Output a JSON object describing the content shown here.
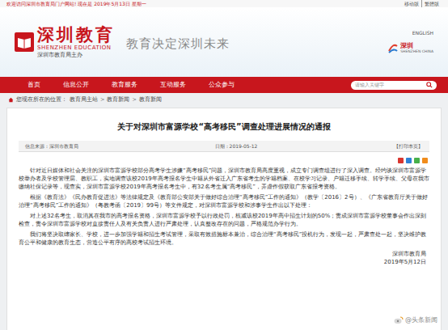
{
  "topbar": {
    "welcome": "欢迎访问深圳市教育局门户网站! 现在是 2019年5月13日 星期一",
    "links": [
      "移动版",
      "繁體版"
    ]
  },
  "header": {
    "brand": "深圳教育",
    "brand_en": "SHENZHEN EDUCATION",
    "sponsor": "深圳市教育局主办",
    "slogan": "教育决定深圳未来",
    "english": "ENGLISH",
    "city_logo": "深圳",
    "city_logo_en": "SHENZHEN CHINA"
  },
  "nav": {
    "items": [
      {
        "label": "首页",
        "selected": false
      },
      {
        "label": "信息公开",
        "selected": false
      },
      {
        "label": "教育服务",
        "selected": false
      },
      {
        "label": "互动服务",
        "selected": false
      },
      {
        "label": "公众参与",
        "selected": false
      }
    ],
    "search_placeholder": "请输入关键字"
  },
  "breadcrumb": {
    "prefix": "您现在所在的位置：",
    "items": [
      "教育局主站",
      "教育新闻",
      "教育新闻"
    ],
    "separator": ">"
  },
  "article": {
    "title": "关于对深圳市富源学校“高考移民”调查处理进展情况的通报",
    "source": "信息来源：深圳市教育局",
    "date": "日期：2019-05-12",
    "print": "【打印本页】",
    "paragraphs": [
      "针对近日媒体和社会关注的深圳市富源学校部分高考学生涉嫌“高考移民”问题，深圳市教育局高度重视，成立专门调查组进行了深入调查。经约谈深圳市富源学校举办者及学校管理层、教职工，实地调查该校2019年高考报名学生中籍从外省迁入广东省考生的学籍档案、在校学习记录、户籍迁移手续、转学手续、父母在我市缴纳社保记录等，现查实，深圳市富源学校2019年高考报名考生中，有32名考生属“高考移民”，弄虚作假获取广东省报考资格。",
      "根据《教育法》《民办教育促进法》等法律规定及《教育部公安部关于做好综合治理“高考移民”工作的通知》（教学〔2016〕2号）、《广东省教育厅关于做好治理“高考移民”工作的通知》（粤教考函〔2019〕99号）等文件规定，对深圳市富源学校和涉事学生作出以下处理：",
      "对上述32名考生，取消其在我市的高考报名资格，深圳市富源学校予以行政处罚，核减该校2019年高中招生计划的50%；责成深圳市富源学校董事会作出深刻检查，责令深圳市富源学校对直接责任人及有关负责人进行严肃处理，认真整改存在的问题，严格规范办学行为。",
      "我们将坚决取缔家长、学校，进一步加强学籍和招生考试管理，采取有效措施标本兼治，综合治理“高考移民”投机行为，发现一起，严肃查处一起，坚决维护教育公平和健康的教育生态，营造公平有序的高校考试招生环境。"
    ],
    "signature": {
      "org": "深圳市教育局",
      "date": "2019年5月12日"
    }
  },
  "watermark": "@头条新闻"
}
